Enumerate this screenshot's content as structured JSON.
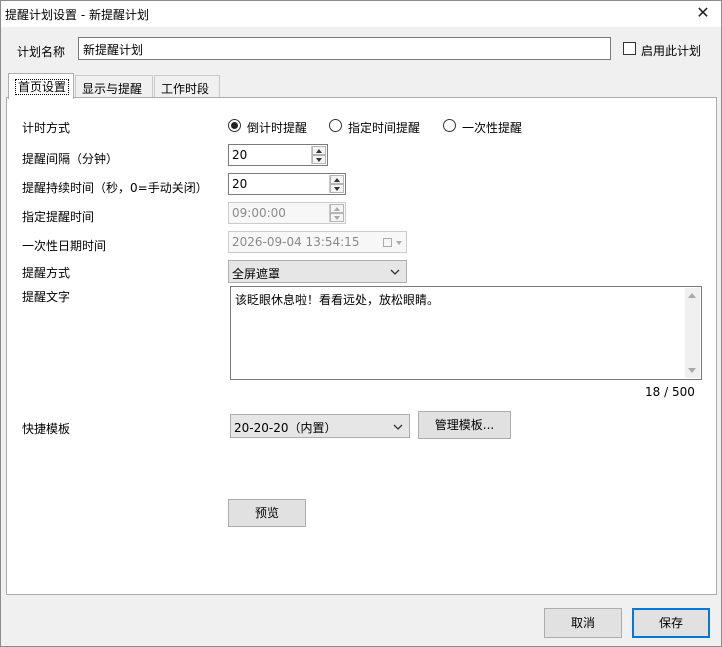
{
  "window": {
    "title": "提醒计划设置 - 新提醒计划",
    "close_glyph": "✕"
  },
  "plan": {
    "name_label": "计划名称",
    "name_value": "新提醒计划",
    "enable_label": "启用此计划"
  },
  "tabs": [
    {
      "label": "首页设置",
      "active": true
    },
    {
      "label": "显示与提醒",
      "active": false
    },
    {
      "label": "工作时段",
      "active": false
    }
  ],
  "form": {
    "timer_mode_label": "计时方式",
    "timer_modes": [
      {
        "label": "倒计时提醒",
        "checked": true
      },
      {
        "label": "指定时间提醒",
        "checked": false
      },
      {
        "label": "一次性提醒",
        "checked": false
      }
    ],
    "interval_label": "提醒间隔（分钟）",
    "interval_value": "20",
    "duration_label": "提醒持续时间（秒，0=手动关闭）",
    "duration_value": "20",
    "fixed_time_label": "指定提醒时间",
    "fixed_time_value": "09:00:00",
    "once_datetime_label": "一次性日期时间",
    "once_datetime_value": "2026-09-04 13:54:15",
    "method_label": "提醒方式",
    "method_value": "全屏遮罩",
    "text_label": "提醒文字",
    "text_value": "该眨眼休息啦！看看远处，放松眼睛。",
    "char_count": "18 / 500",
    "template_label": "快捷模板",
    "template_value": "20-20-20（内置）",
    "manage_templates_label": "管理模板...",
    "preview_label": "预览"
  },
  "footer": {
    "cancel_label": "取消",
    "save_label": "保存"
  },
  "colors": {
    "accent": "#0078d7"
  }
}
